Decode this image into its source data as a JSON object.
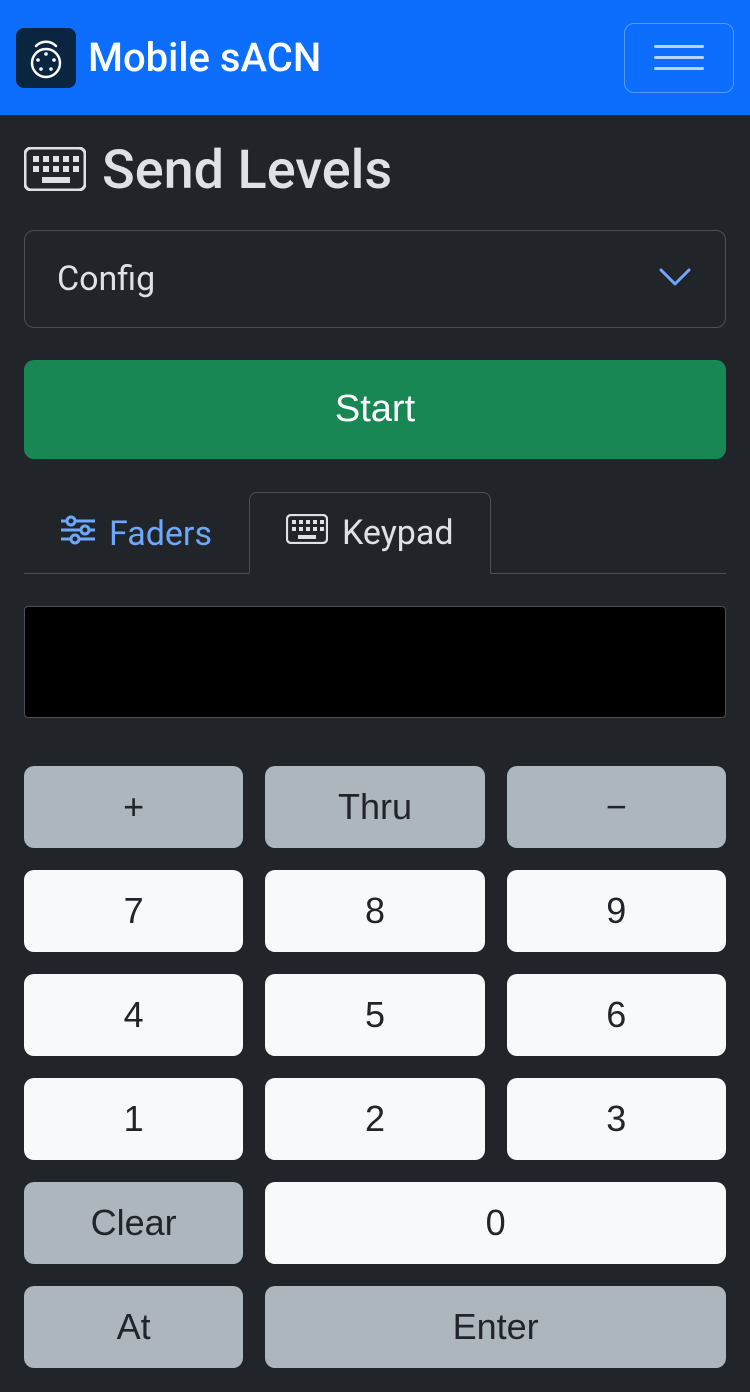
{
  "navbar": {
    "title": "Mobile sACN"
  },
  "page": {
    "title": "Send Levels"
  },
  "config": {
    "label": "Config"
  },
  "start": {
    "label": "Start"
  },
  "tabs": {
    "faders": "Faders",
    "keypad": "Keypad"
  },
  "keypad": {
    "display": "",
    "plus": "+",
    "thru": "Thru",
    "minus": "−",
    "k7": "7",
    "k8": "8",
    "k9": "9",
    "k4": "4",
    "k5": "5",
    "k6": "6",
    "k1": "1",
    "k2": "2",
    "k3": "3",
    "clear": "Clear",
    "k0": "0",
    "at": "At",
    "enter": "Enter"
  }
}
